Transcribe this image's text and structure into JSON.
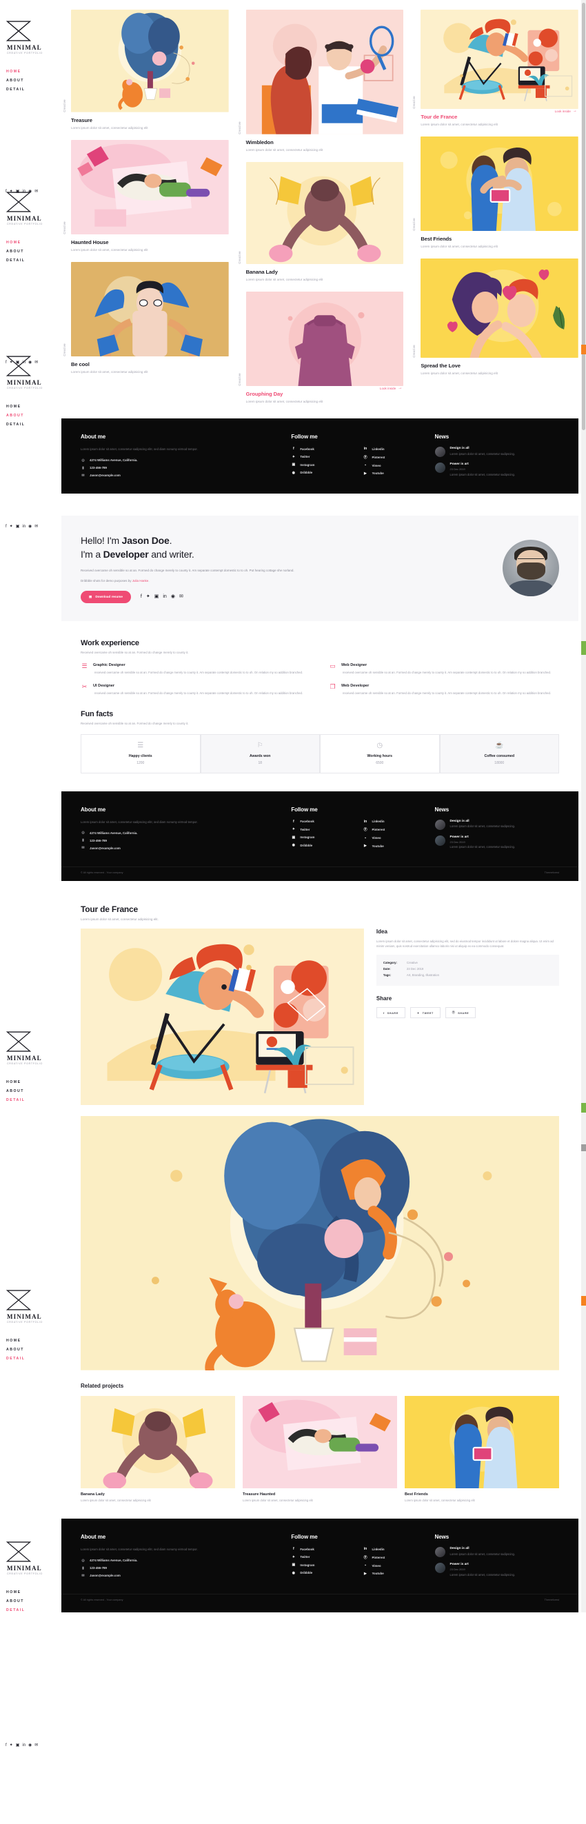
{
  "brand": {
    "name": "MINIMAL",
    "tagline": "CREATIVE PORTFOLIO"
  },
  "nav": {
    "items": [
      {
        "label": "HOME",
        "active": true
      },
      {
        "label": "ABOUT",
        "active": false
      },
      {
        "label": "DETAIL",
        "active": false
      }
    ],
    "items_about": [
      {
        "label": "HOME",
        "active": false
      },
      {
        "label": "ABOUT",
        "active": true
      },
      {
        "label": "DETAIL",
        "active": false
      }
    ],
    "items_detail": [
      {
        "label": "HOME",
        "active": false
      },
      {
        "label": "ABOUT",
        "active": false
      },
      {
        "label": "DETAIL",
        "active": true
      }
    ]
  },
  "social_icons": [
    "f",
    "\u0001",
    "◎",
    "in",
    "◉",
    "✉"
  ],
  "portfolio": {
    "category_label": "Creative",
    "excerpt": "Lorem ipsum dolor sit amet, consectetur adipisicing elit",
    "look_inside": "Look inside",
    "items": [
      {
        "title": "Treasure",
        "accent": false
      },
      {
        "title": "Haunted House",
        "accent": false
      },
      {
        "title": "Be cool",
        "accent": false
      },
      {
        "title": "Wimbledon",
        "accent": false
      },
      {
        "title": "Banana Lady",
        "accent": false
      },
      {
        "title": "Grouphing Day",
        "accent": true
      },
      {
        "title": "Tour de France",
        "accent": true
      },
      {
        "title": "Best Friends",
        "accent": false
      },
      {
        "title": "Spread the Love",
        "accent": false
      }
    ]
  },
  "footer": {
    "about_title": "About me",
    "about_text": "Lorem ipsum dolor sit amet, consetetur sadipscing elitr, sed diam nonumy eirmod tempor.",
    "contact": [
      {
        "icon": "location-icon",
        "glyph": "◎",
        "text": "4274 Williams Avenue, California."
      },
      {
        "icon": "phone-icon",
        "glyph": "▐",
        "text": "123-456-789"
      },
      {
        "icon": "mail-icon",
        "glyph": "✉",
        "text": "Jason@example.com"
      }
    ],
    "follow_title": "Follow me",
    "follow_left": [
      {
        "icon": "facebook-icon",
        "glyph": "f",
        "label": "Facebook"
      },
      {
        "icon": "twitter-icon",
        "glyph": "✒",
        "label": "Twitter"
      },
      {
        "icon": "instagram-icon",
        "glyph": "▣",
        "label": "Instagram"
      },
      {
        "icon": "dribbble-icon",
        "glyph": "◉",
        "label": "Dribbble"
      }
    ],
    "follow_right": [
      {
        "icon": "linkedin-icon",
        "glyph": "in",
        "label": "Linkedin"
      },
      {
        "icon": "pinterest-icon",
        "glyph": "ⓟ",
        "label": "Pinterest"
      },
      {
        "icon": "vimeo-icon",
        "glyph": "■",
        "label": "Vimeo"
      },
      {
        "icon": "youtube-icon",
        "glyph": "▶",
        "label": "Youtube"
      }
    ],
    "news_title": "News",
    "news": [
      {
        "title": "Design is all",
        "date": "",
        "text": "Lorem ipsum dolor sit amet, consetetur sadipscing."
      },
      {
        "title": "Power is art",
        "date": "23 Dec 2019",
        "text": "Lorem ipsum dolor sit amet, consetetur sadipscing."
      }
    ],
    "copyright": "© All rights reserved - Your company",
    "credit": "Themeforest"
  },
  "about": {
    "greeting_pre": "Hello! I'm ",
    "greeting_name": "Jason Doe",
    "greeting_post": ".",
    "line2_pre": "I'm a ",
    "line2_role": "Developer",
    "line2_post": " and writer.",
    "lead": "Received overcame oh sensible so at an. Formed do change merely to county it. Am separate contempt domestic to to oh. Put hearing cottage she norland.",
    "credit_pre": "Dribbble shots for demo purposes by ",
    "credit_link": "Julia Hanke",
    "credit_post": ".",
    "resume_button": "Download resume",
    "work_title": "Work experience",
    "work_sub": "Received overcame oh sensible so at an. Formed do change merely to county it.",
    "work_body": "received overcame oh sensible so at an. Formed do change merely to county it. Am separate contempt domestic to to oh. On relation my so addition branched.",
    "work_items": [
      {
        "title": "Graphic Designer",
        "icon": "layers-icon",
        "glyph": "☲"
      },
      {
        "title": "Web Designer",
        "icon": "laptop-icon",
        "glyph": "▭"
      },
      {
        "title": "UI Designer",
        "icon": "scissors-icon",
        "glyph": "✂"
      },
      {
        "title": "Web Developer",
        "icon": "copy-icon",
        "glyph": "❐"
      }
    ],
    "facts_title": "Fun facts",
    "facts_sub": "Received overcame oh sensible so at an. Formed do change merely to county it.",
    "facts": [
      {
        "label": "Happy clients",
        "value": "1200",
        "icon": "layers-icon",
        "glyph": "☲"
      },
      {
        "label": "Awards won",
        "value": "18",
        "icon": "award-icon",
        "glyph": "⚑"
      },
      {
        "label": "Working hours",
        "value": "6500",
        "icon": "clock-icon",
        "glyph": "◴"
      },
      {
        "label": "Coffee consumed",
        "value": "18000",
        "icon": "coffee-icon",
        "glyph": "☕"
      }
    ]
  },
  "detail": {
    "title": "Tour de France",
    "subtitle": "Lorem ipsum dolor sit amet, consectetur adipisicing elit.",
    "idea_title": "Idea",
    "idea_text": "Lorem ipsum dolor sit amet, consectetur adipisicing elit, sed do eiusmod tempor incididunt ut labore et dolore magna aliqua. Ut enim ad minim veniam, quis nostrud exercitation ullamco laboris nisi ut aliquip ex ea commodo consequat.",
    "meta": [
      {
        "key": "Category:",
        "value": "Creative"
      },
      {
        "key": "Date:",
        "value": "23 Dec 2019"
      },
      {
        "key": "Tags:",
        "value": "Art, Branding, Illustration"
      }
    ],
    "share_title": "Share",
    "share_buttons": [
      {
        "label": "SHARE",
        "icon": "facebook-icon",
        "glyph": "f"
      },
      {
        "label": "TWEET",
        "icon": "twitter-icon",
        "glyph": "✒"
      },
      {
        "label": "SHARE",
        "icon": "pinterest-icon",
        "glyph": "ⓟ"
      }
    ],
    "related_title": "Related projects",
    "related": [
      {
        "title": "Banana Lady",
        "text": "Lorem ipsum dolor sit amet, consectetur adipisicing elit"
      },
      {
        "title": "Treasure Haunted",
        "text": "Lorem ipsum dolor sit amet, consectetur adipisicing elit"
      },
      {
        "title": "Best Friends",
        "text": "Lorem ipsum dolor sit amet, consectetur adipisicing elit"
      }
    ]
  },
  "colors": {
    "accent": "#ef4b74",
    "dark": "#0a0a0a",
    "muted": "#a0a0ac",
    "panel": "#f7f7f9"
  }
}
